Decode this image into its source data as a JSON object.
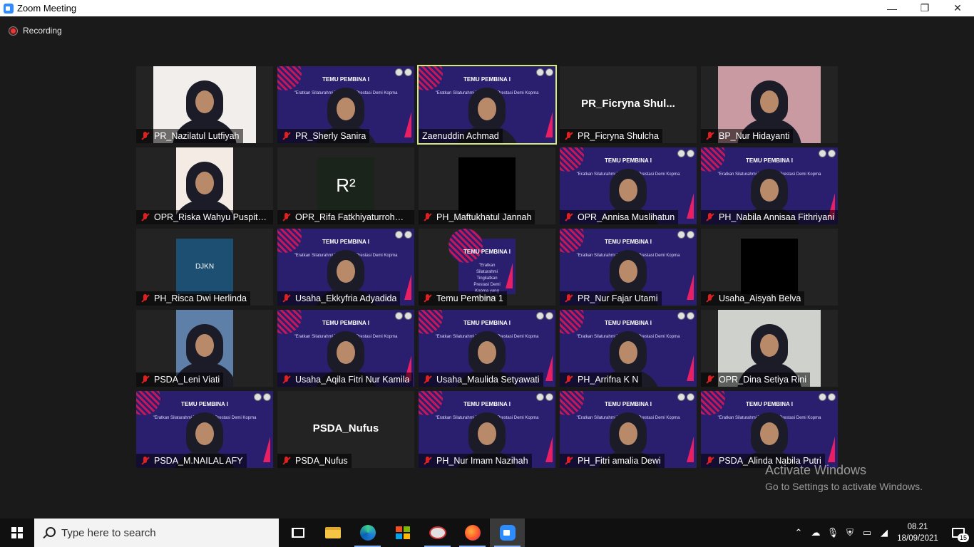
{
  "window": {
    "title": "Zoom Meeting",
    "minimize": "—",
    "restore": "❐",
    "close": "✕"
  },
  "recording": {
    "label": "Recording"
  },
  "banner": {
    "title": "TEMU PEMBINA I",
    "subtitle": "\"Eratkan Silaturahmi Tingkatkan Prestasi Demi Kopma yang Bersinergi\""
  },
  "tiles": [
    {
      "name": "PR_Nazilatul Lutfiyah",
      "type": "camera",
      "bg": "#f1eeec",
      "muted": true
    },
    {
      "name": "PR_Sherly Sanira",
      "type": "banner-camera",
      "muted": true
    },
    {
      "name": "Zaenuddin Achmad",
      "type": "banner-camera",
      "muted": false,
      "active": true
    },
    {
      "name": "PR_Ficryna Shulcha",
      "type": "name-only",
      "display": "PR_Ficryna  Shul...",
      "muted": true
    },
    {
      "name": "BP_Nur Hidayanti",
      "type": "camera",
      "bg": "#c99aa2",
      "muted": true
    },
    {
      "name": "OPR_Riska Wahyu Puspitas...",
      "type": "camera-small",
      "bg": "#f4ece4",
      "muted": true
    },
    {
      "name": "OPR_Rifa Fatkhiyaturrohmah",
      "type": "avatar",
      "bg": "#1a241a",
      "avatarText": "R²",
      "muted": true
    },
    {
      "name": "PH_Maftukhatul Jannah",
      "type": "black",
      "muted": true
    },
    {
      "name": "OPR_Annisa Muslihatun",
      "type": "banner-camera",
      "muted": true
    },
    {
      "name": "PH_Nabila Annisaa Fithriyani",
      "type": "banner-camera",
      "muted": true
    },
    {
      "name": "PH_Risca Dwi Herlinda",
      "type": "avatar",
      "bg": "#1d4f73",
      "avatarText": "DJKN",
      "muted": true
    },
    {
      "name": "Usaha_Ekkyfria Adyadida",
      "type": "banner-camera",
      "muted": true
    },
    {
      "name": "Temu Pembina 1",
      "type": "banner-small",
      "muted": true
    },
    {
      "name": "PR_Nur Fajar Utami",
      "type": "banner-camera",
      "muted": true
    },
    {
      "name": "Usaha_Aisyah Belva",
      "type": "black",
      "muted": true
    },
    {
      "name": "PSDA_Leni Viati",
      "type": "camera-small",
      "bg": "#5e7fa8",
      "muted": true
    },
    {
      "name": "Usaha_Aqila Fitri Nur Kamila",
      "type": "banner-camera",
      "muted": true
    },
    {
      "name": "Usaha_Maulida Setyawati",
      "type": "banner-camera",
      "muted": true
    },
    {
      "name": "PH_Arrifna K N",
      "type": "banner-camera",
      "muted": true
    },
    {
      "name": "OPR_Dina Setiya Rini",
      "type": "camera",
      "bg": "#cfd2cc",
      "muted": true
    },
    {
      "name": "PSDA_M.NAILAL AFY",
      "type": "banner-camera",
      "muted": true
    },
    {
      "name": "PSDA_Nufus",
      "type": "name-only",
      "display": "PSDA_Nufus",
      "muted": true
    },
    {
      "name": "PH_Nur Imam Nazihah",
      "type": "banner-camera",
      "muted": true
    },
    {
      "name": "PH_Fitri amalia Dewi",
      "type": "banner-camera",
      "muted": true
    },
    {
      "name": "PSDA_Alinda Nabila Putri",
      "type": "banner-camera",
      "muted": true
    }
  ],
  "watermark": {
    "line1": "Activate Windows",
    "line2": "Go to Settings to activate Windows."
  },
  "taskbar": {
    "search_placeholder": "Type here to search",
    "apps": [
      "task-view",
      "file-explorer",
      "edge",
      "store",
      "paint",
      "firefox",
      "zoom"
    ],
    "time": "08.21",
    "date": "18/09/2021",
    "notifications": "15"
  }
}
